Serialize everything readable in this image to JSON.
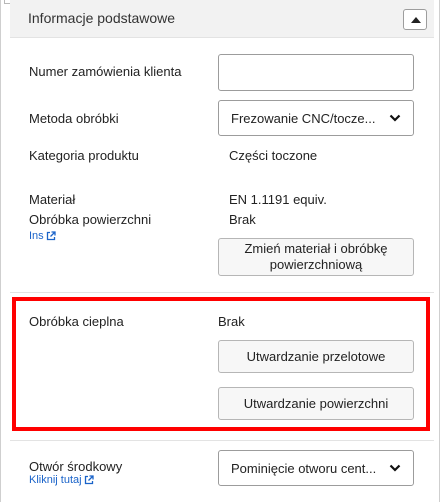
{
  "section": {
    "title": "Informacje podstawowe"
  },
  "fields": {
    "order_number_label": "Numer zamówienia klienta",
    "order_number_value": "",
    "method_label": "Metoda obróbki",
    "method_value": "Frezowanie CNC/tocze...",
    "category_label": "Kategoria produktu",
    "category_value": "Części toczone",
    "material_label": "Materiał",
    "material_value": "EN 1.1191 equiv.",
    "surface_label": "Obróbka powierzchni",
    "surface_value": "Brak",
    "ins_link": "Ins",
    "change_button": "Zmień materiał i obróbkę powierzchniową",
    "heat_label": "Obróbka cieplna",
    "heat_value": "Brak",
    "through_hardening_button": "Utwardzanie przelotowe",
    "surface_hardening_button": "Utwardzanie powierzchni",
    "center_hole_label": "Otwór środkowy",
    "center_hole_link": "Kliknij tutaj",
    "center_hole_value": "Pominięcie otworu cent..."
  },
  "colors": {
    "highlight": "#ff0000",
    "link": "#1a63c9"
  },
  "icons": {
    "collapse": "triangle-up-icon",
    "dropdown": "chevron-down-icon",
    "external": "external-link-icon"
  }
}
